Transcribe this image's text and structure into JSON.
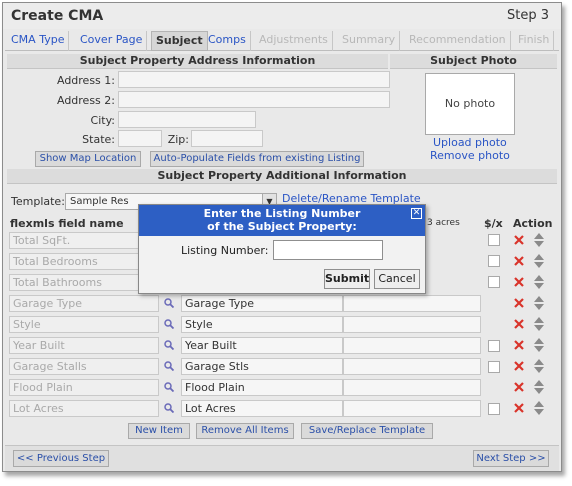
{
  "window": {
    "title": "Create CMA",
    "step": "Step 3"
  },
  "tabs": [
    {
      "label": "CMA Type",
      "state": "enabled"
    },
    {
      "label": "Cover Page",
      "state": "enabled"
    },
    {
      "label": "Subject",
      "state": "active"
    },
    {
      "label": "Comps",
      "state": "enabled"
    },
    {
      "label": "Adjustments",
      "state": "disabled"
    },
    {
      "label": "Summary",
      "state": "disabled"
    },
    {
      "label": "Recommendation",
      "state": "disabled"
    },
    {
      "label": "Finish",
      "state": "disabled"
    }
  ],
  "address_section": {
    "heading": "Subject Property Address Information",
    "address1_label": "Address 1:",
    "address2_label": "Address 2:",
    "city_label": "City:",
    "state_label": "State:",
    "zip_label": "Zip:",
    "show_map_button": "Show Map Location",
    "auto_populate_button": "Auto-Populate Fields from existing Listing"
  },
  "photo_section": {
    "heading": "Subject Photo",
    "placeholder": "No photo",
    "upload_link": "Upload photo",
    "remove_link": "Remove photo"
  },
  "additional_section": {
    "heading": "Subject Property Additional Information",
    "template_label": "Template:",
    "template_value": "Sample Res",
    "delete_rename_link": "Delete/Rename Template",
    "col_field_name": "flexmls field name",
    "col_extra_fragment": "3 acres",
    "col_dollar": "$/x",
    "col_action": "Action"
  },
  "rows": [
    {
      "field": "Total SqFt.",
      "value": "",
      "has_checkbox": true
    },
    {
      "field": "Total Bedrooms",
      "value": "",
      "has_checkbox": true
    },
    {
      "field": "Total Bathrooms",
      "value": "",
      "has_checkbox": true
    },
    {
      "field": "Garage Type",
      "value": "Garage Type",
      "has_checkbox": false
    },
    {
      "field": "Style",
      "value": "Style",
      "has_checkbox": false
    },
    {
      "field": "Year Built",
      "value": "Year Built",
      "has_checkbox": true
    },
    {
      "field": "Garage Stalls",
      "value": "Garage Stls",
      "has_checkbox": true
    },
    {
      "field": "Flood Plain",
      "value": "Flood Plain",
      "has_checkbox": false
    },
    {
      "field": "Lot Acres",
      "value": "Lot Acres",
      "has_checkbox": true
    }
  ],
  "actions": {
    "new_item": "New Item",
    "remove_all": "Remove All Items",
    "save_replace": "Save/Replace Template"
  },
  "footer": {
    "prev": "<< Previous Step",
    "next": "Next Step >>"
  },
  "modal": {
    "title_line1": "Enter the Listing Number",
    "title_line2": "of the Subject Property:",
    "label": "Listing Number:",
    "input_value": "",
    "submit": "Submit",
    "cancel": "Cancel"
  },
  "colors": {
    "link": "#2a55c5",
    "modal_header": "#2d5fc4",
    "delete_x": "#d9342b"
  },
  "icons": [
    "magnifier-icon",
    "delete-x-icon",
    "move-updown-icon",
    "close-icon",
    "dropdown-arrow-icon"
  ]
}
